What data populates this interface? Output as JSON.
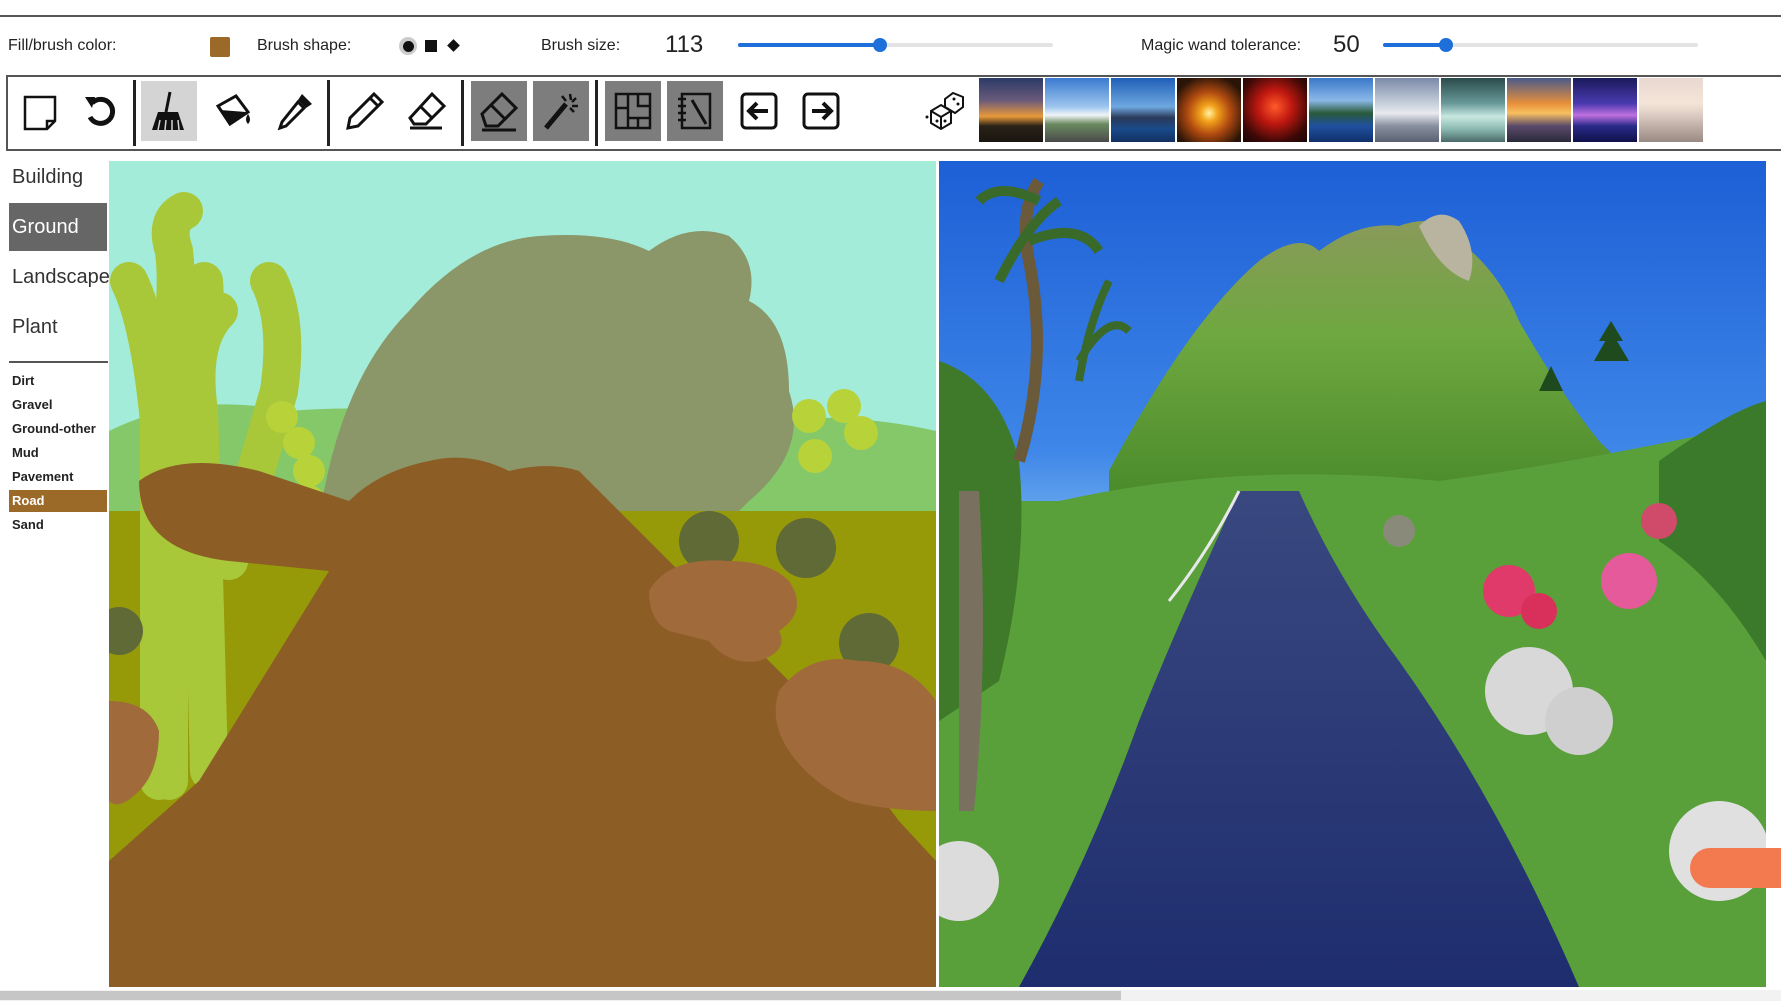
{
  "options": {
    "fill_color_label": "Fill/brush color:",
    "fill_color": "#9b6a28",
    "brush_shape_label": "Brush shape:",
    "brush_shapes": [
      "circle-icon",
      "square-icon",
      "diamond-icon"
    ],
    "brush_size_label": "Brush size:",
    "brush_size": "113",
    "brush_size_fraction": 0.45,
    "wand_label": "Magic wand tolerance:",
    "wand_tolerance": "50",
    "wand_fraction": 0.2,
    "accent": "#1e6fd9"
  },
  "toolbar": {
    "tools": [
      "new-canvas-icon",
      "undo-icon",
      "broom-icon",
      "paint-bucket-icon",
      "eyedropper-icon",
      "pencil-icon",
      "eraser-icon",
      "big-eraser-icon",
      "magic-wand-icon",
      "segment-icon",
      "notebook-icon",
      "arrow-left-icon",
      "arrow-right-icon",
      "dice-icon"
    ],
    "style_thumbnails": [
      "sunset-coast",
      "road-sky",
      "blue-lake",
      "golden-sunset",
      "red-sky",
      "mountain-lake",
      "cloudy-sea",
      "palm-shore",
      "orange-clouds",
      "purple-dusk",
      "pale-beach"
    ]
  },
  "sidebar": {
    "categories": [
      {
        "label": "Building",
        "selected": false
      },
      {
        "label": "Ground",
        "selected": true
      },
      {
        "label": "Landscape",
        "selected": false
      },
      {
        "label": "Plant",
        "selected": false
      }
    ],
    "subcategories": [
      {
        "label": "Dirt",
        "selected": false
      },
      {
        "label": "Gravel",
        "selected": false
      },
      {
        "label": "Ground-other",
        "selected": false
      },
      {
        "label": "Mud",
        "selected": false
      },
      {
        "label": "Pavement",
        "selected": false
      },
      {
        "label": "Road",
        "selected": true
      },
      {
        "label": "Sand",
        "selected": false
      }
    ]
  },
  "colors": {
    "sky": "#a3ecd9",
    "mountain": "#8b9669",
    "hill": "#84c86a",
    "ground": "#969a09",
    "road": "#8c5e26",
    "dirt": "#a06a3a",
    "tree": "#a8c83a",
    "bush": "#5f6a36",
    "dot": "#b8d23a"
  }
}
